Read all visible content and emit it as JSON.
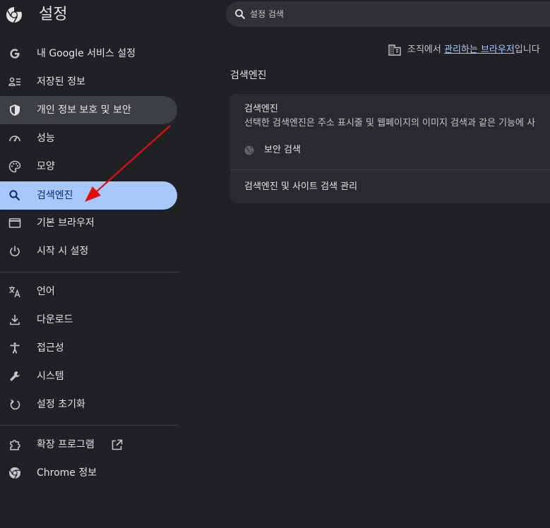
{
  "header": {
    "title": "설정",
    "search_placeholder": "설정 검색"
  },
  "sidebar": {
    "items": [
      {
        "label": "내 Google 서비스 설정",
        "icon": "google-icon"
      },
      {
        "label": "저장된 정보",
        "icon": "saved-info-icon"
      },
      {
        "label": "개인 정보 보호 및 보안",
        "icon": "shield-icon"
      },
      {
        "label": "성능",
        "icon": "speedometer-icon"
      },
      {
        "label": "모양",
        "icon": "palette-icon"
      },
      {
        "label": "검색엔진",
        "icon": "search-icon"
      },
      {
        "label": "기본 브라우저",
        "icon": "browser-window-icon"
      },
      {
        "label": "시작 시 설정",
        "icon": "power-icon"
      },
      {
        "label": "언어",
        "icon": "translate-icon"
      },
      {
        "label": "다운로드",
        "icon": "download-icon"
      },
      {
        "label": "접근성",
        "icon": "accessibility-icon"
      },
      {
        "label": "시스템",
        "icon": "wrench-icon"
      },
      {
        "label": "설정 초기화",
        "icon": "reset-icon"
      },
      {
        "label": "확장 프로그램",
        "icon": "extension-icon"
      },
      {
        "label": "Chrome 정보",
        "icon": "chrome-icon"
      }
    ],
    "active_index": 5,
    "hover_index": 2
  },
  "org_notice": {
    "prefix": "조직에서 ",
    "link": "관리하는 브라우저",
    "suffix": "입니다"
  },
  "main": {
    "section_title": "검색엔진",
    "card": {
      "title": "검색엔진",
      "description": "선택한 검색엔진은 주소 표시줄 및 웹페이지의 이미지 검색과 같은 기능에 사",
      "engine": "보안 검색",
      "manage_label": "검색엔진 및 사이트 검색 관리"
    }
  },
  "colors": {
    "background": "#202124",
    "active_nav": "#a8c7fa",
    "hover_nav": "#3c4043",
    "link": "#a8c7fa",
    "annotation_arrow": "#e01010"
  }
}
